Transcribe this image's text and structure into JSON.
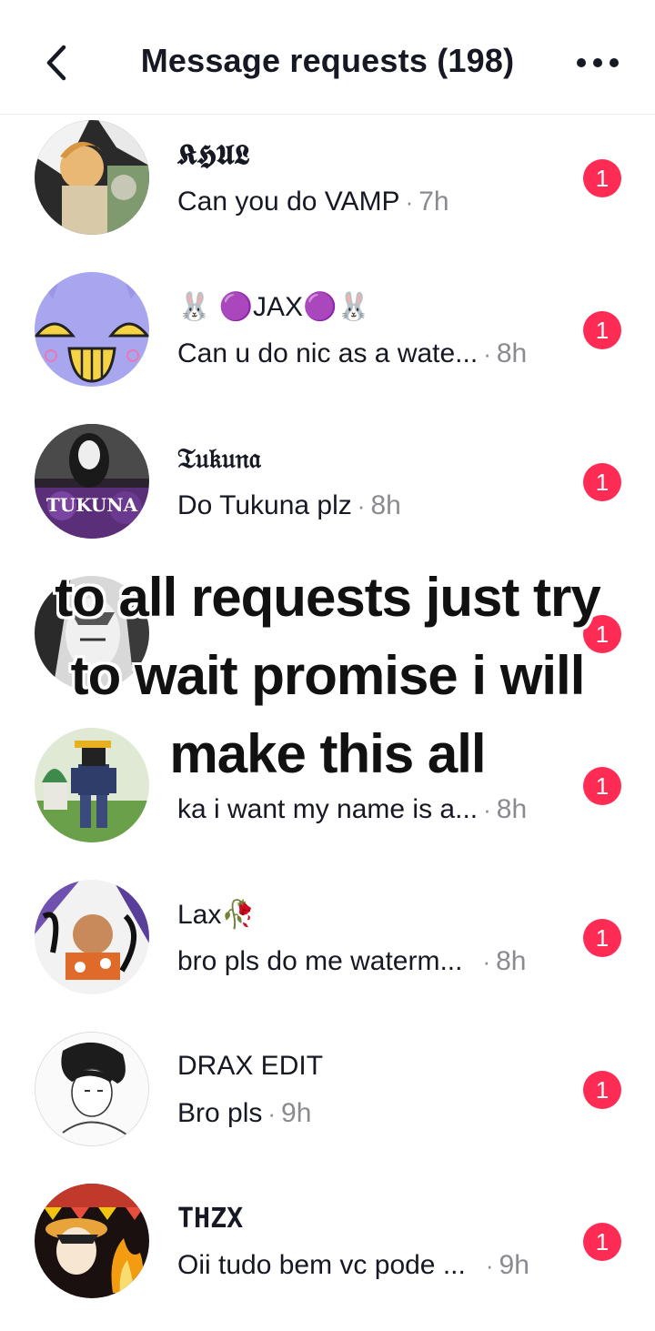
{
  "header": {
    "title": "Message requests (198)"
  },
  "colors": {
    "badge": "#fe2c55",
    "muted": "#8a8b91",
    "text": "#161823"
  },
  "requests": [
    {
      "name": "𝕶𝕳𝖀𝕷",
      "message": "Can you do VAMP",
      "time": "7h",
      "badge": "1",
      "avatar_icon": "anime-portrait-avatar"
    },
    {
      "name": "🐰 🟣JAX🟣🐰",
      "message": "Can u do nic as a wate...",
      "time": "8h",
      "badge": "1",
      "avatar_icon": "jax-face-avatar"
    },
    {
      "name": "𝔗𝔲𝔨𝔲𝔫𝔞",
      "message": "Do Tukuna plz",
      "time": "8h",
      "badge": "1",
      "avatar_icon": "tukuna-avatar",
      "avatar_text": "TUKUNA"
    },
    {
      "name": "",
      "message": "",
      "time": "",
      "badge": "1",
      "avatar_icon": "monochrome-anime-avatar"
    },
    {
      "name": "",
      "message": "ka i want my name is a...",
      "time": "8h",
      "badge": "1",
      "avatar_icon": "roblox-character-avatar"
    },
    {
      "name": "Lax🥀",
      "message": "bro pls do me waterm...",
      "time": "8h",
      "badge": "1",
      "avatar_icon": "collage-avatar"
    },
    {
      "name": "DRAX EDIT",
      "message": "Bro pls",
      "time": "9h",
      "badge": "1",
      "avatar_icon": "sketch-portrait-avatar"
    },
    {
      "name": "THZX",
      "message": "Oii tudo bem vc pode ...",
      "time": "9h",
      "badge": "1",
      "avatar_icon": "bonfire-anime-avatar"
    }
  ],
  "overlay": {
    "lines": [
      "to all requests just try",
      "to wait promise i will",
      "make this all"
    ]
  }
}
